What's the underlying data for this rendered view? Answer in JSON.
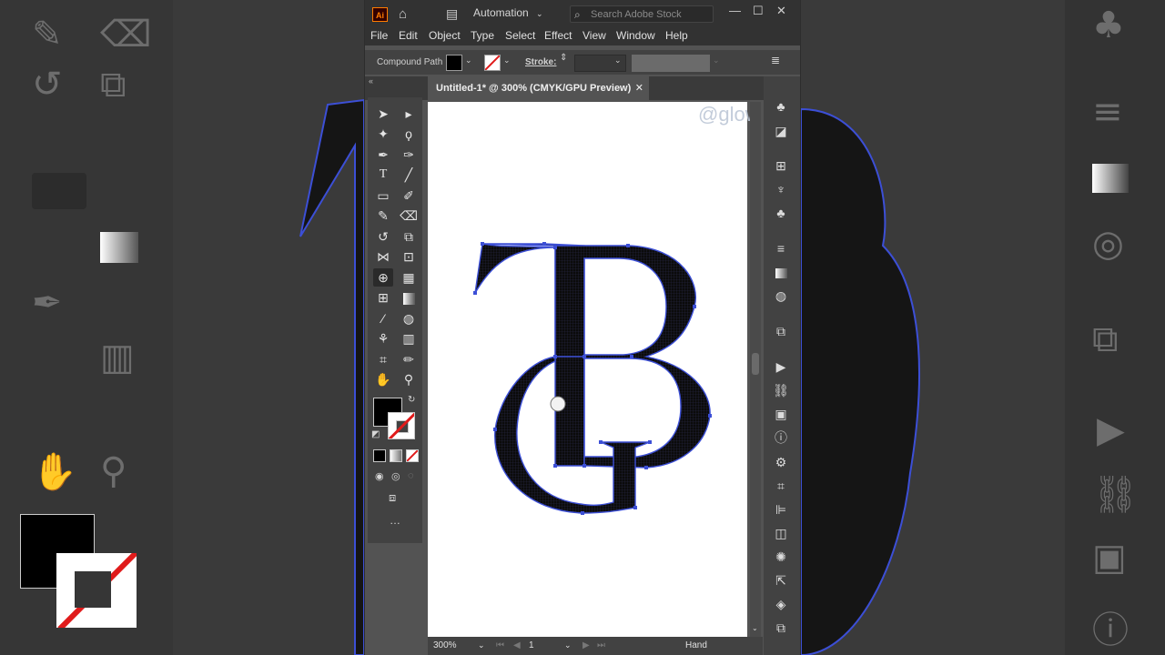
{
  "window": {
    "logo": "Ai",
    "workspace": "Automation",
    "search_placeholder": "Search Adobe Stock",
    "controls": {
      "minimize": "—",
      "restore": "☐",
      "close": "✕"
    }
  },
  "menu": [
    "File",
    "Edit",
    "Object",
    "Type",
    "Select",
    "Effect",
    "View",
    "Window",
    "Help"
  ],
  "control_bar": {
    "selection_type": "Compound Path",
    "stroke_label": "Stroke:"
  },
  "document_tab": {
    "title": "Untitled-1* @ 300% (CMYK/GPU Preview)",
    "close": "✕"
  },
  "watermark": "@glow",
  "status_bar": {
    "zoom": "300%",
    "artboard_number": "1",
    "current_tool": "Hand"
  },
  "colors": {
    "fill": "#000000",
    "stroke": "none",
    "path_highlight": "#3c4fd6",
    "ui_dark": "#323232",
    "ui_mid": "#424242",
    "ui_canvas": "#535353"
  },
  "tools_icons": [
    "selection-arrow-icon",
    "direct-selection-icon",
    "magic-wand-icon",
    "lasso-icon",
    "pen-icon",
    "curvature-icon",
    "type-icon",
    "line-icon",
    "rectangle-icon",
    "paintbrush-icon",
    "shaper-icon",
    "eraser-icon",
    "rotate-icon",
    "scale-icon",
    "width-icon",
    "free-transform-icon",
    "shape-builder-icon",
    "perspective-grid-icon",
    "mesh-icon",
    "gradient-icon",
    "eyedropper-icon",
    "blend-icon",
    "symbol-sprayer-icon",
    "graph-icon",
    "artboard-icon",
    "slice-icon",
    "hand-icon",
    "zoom-icon"
  ],
  "more_tools": "…"
}
